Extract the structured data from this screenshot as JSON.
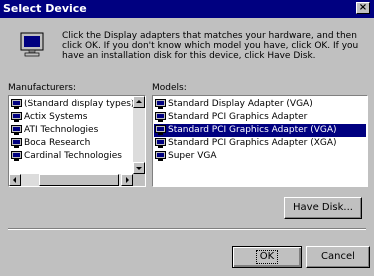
{
  "window": {
    "title": "Select Device",
    "close_glyph": "×"
  },
  "instructions": "Click the Display adapters that matches your hardware, and then click OK. If you don't know which model you have, click OK. If you have an installation disk for this device, click Have Disk.",
  "manufacturers": {
    "label": "Manufacturers:",
    "items": [
      {
        "label": "(Standard display types)",
        "selected": true
      },
      {
        "label": "Actix Systems",
        "selected": false
      },
      {
        "label": "ATI Technologies",
        "selected": false
      },
      {
        "label": "Boca Research",
        "selected": false
      },
      {
        "label": "Cardinal Technologies",
        "selected": false
      }
    ]
  },
  "models": {
    "label": "Models:",
    "items": [
      {
        "label": "Standard Display Adapter (VGA)",
        "selected": false
      },
      {
        "label": "Standard PCI Graphics Adapter",
        "selected": false
      },
      {
        "label": "Standard PCI Graphics Adapter (VGA)",
        "selected": true
      },
      {
        "label": "Standard PCI Graphics Adapter (XGA)",
        "selected": false
      },
      {
        "label": "Super VGA",
        "selected": false
      }
    ]
  },
  "buttons": {
    "have_disk": "Have Disk...",
    "ok": "OK",
    "cancel": "Cancel"
  },
  "icons": {
    "device": "monitor-icon",
    "list_item": "monitor-icon",
    "scroll_up": "arrow-up-icon",
    "scroll_down": "arrow-down-icon",
    "scroll_left": "arrow-left-icon",
    "scroll_right": "arrow-right-icon"
  },
  "colors": {
    "title_bar": "#000080",
    "face": "#c0c0c0",
    "selection": "#000080"
  }
}
